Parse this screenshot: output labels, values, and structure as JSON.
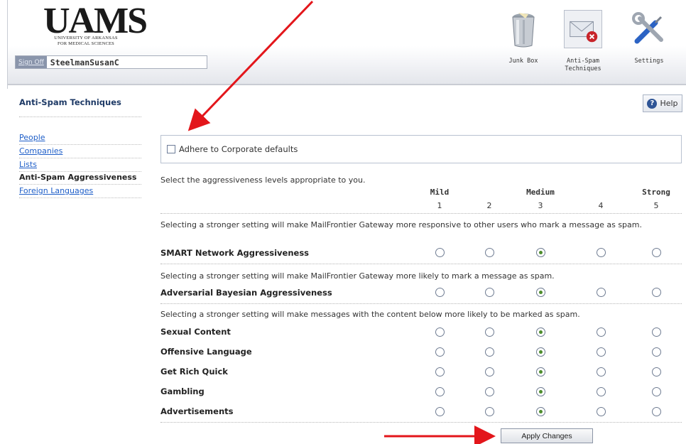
{
  "brand": {
    "logo_text": "UAMS",
    "logo_subtitle_line1": "UNIVERSITY OF ARKANSAS",
    "logo_subtitle_line2": "FOR MEDICAL SCIENCES"
  },
  "user": {
    "sign_off_label": "Sign Off",
    "username": "SteelmanSusanC"
  },
  "nav": [
    {
      "label": "Junk Box",
      "icon": "trash-can-icon"
    },
    {
      "label": "Anti-Spam Techniques",
      "icon": "spam-envelope-icon",
      "active": true
    },
    {
      "label": "Settings",
      "icon": "tools-icon"
    }
  ],
  "help": {
    "label": "Help",
    "icon": "help-icon"
  },
  "sidebar": {
    "title": "Anti-Spam Techniques",
    "items": [
      {
        "label": "People",
        "link": true
      },
      {
        "label": "Companies",
        "link": true
      },
      {
        "label": "Lists",
        "link": true
      },
      {
        "label": "Anti-Spam Aggressiveness",
        "link": false,
        "current": true
      },
      {
        "label": "Foreign Languages",
        "link": true
      }
    ]
  },
  "main": {
    "corporate_defaults_label": "Adhere to Corporate defaults",
    "corporate_defaults_checked": false,
    "intro": "Select the aggressiveness levels appropriate to you.",
    "level_headings": {
      "mild": "Mild",
      "medium": "Medium",
      "strong": "Strong"
    },
    "level_numbers": [
      "1",
      "2",
      "3",
      "4",
      "5"
    ],
    "smart_description": "Selecting a stronger setting will make MailFrontier Gateway more responsive to other users who mark a message as spam.",
    "bayesian_description": "Selecting a stronger setting will make MailFrontier Gateway more likely to mark a message as spam.",
    "content_description": "Selecting a stronger setting will make messages with the content below more likely to be marked as spam.",
    "rows": [
      {
        "label": "SMART Network Aggressiveness",
        "selected": 3
      },
      {
        "label": "Adversarial Bayesian Aggressiveness",
        "selected": 3
      },
      {
        "label": "Sexual Content",
        "selected": 3
      },
      {
        "label": "Offensive Language",
        "selected": 3
      },
      {
        "label": "Get Rich Quick",
        "selected": 3
      },
      {
        "label": "Gambling",
        "selected": 3
      },
      {
        "label": "Advertisements",
        "selected": 3
      }
    ],
    "apply_label": "Apply Changes"
  },
  "colors": {
    "annotation_arrow": "#e3161b",
    "link": "#1e5ec8",
    "sidebar_title": "#1e3a66",
    "radio_selected": "#4d8d2d"
  }
}
